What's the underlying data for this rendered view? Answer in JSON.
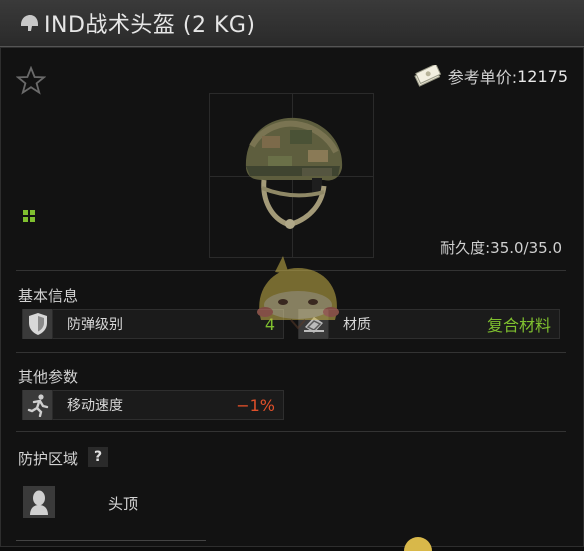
{
  "window": {
    "title": "IND战术头盔 (2 KG)"
  },
  "header": {
    "favorite_icon": "star-icon",
    "price_label": "参考单价:",
    "price_value": "12175"
  },
  "item": {
    "image_icon": "helmet-icon",
    "durability_text": "耐久度:35.0/35.0"
  },
  "sections": {
    "basic": {
      "title": "基本信息",
      "armor_class": {
        "label": "防弹级别",
        "value": "4",
        "icon": "shield-icon",
        "value_color": "#7fbf2f"
      },
      "material": {
        "label": "材质",
        "value": "复合材料",
        "icon": "material-icon",
        "value_color": "#7fbf2f"
      }
    },
    "other": {
      "title": "其他参数",
      "move_speed": {
        "label": "移动速度",
        "value": "−1%",
        "icon": "running-icon",
        "value_color": "#e0502a"
      }
    },
    "protection": {
      "title": "防护区域",
      "help_text": "?",
      "zone": {
        "label": "头顶",
        "icon": "head-icon"
      }
    }
  }
}
